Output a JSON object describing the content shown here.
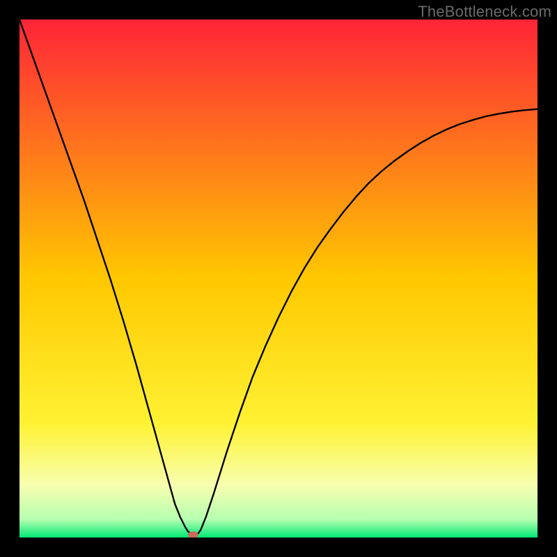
{
  "watermark": "TheBottleneck.com",
  "chart_data": {
    "type": "line",
    "title": "",
    "xlabel": "",
    "ylabel": "",
    "xlim": [
      0,
      1
    ],
    "ylim": [
      0,
      1
    ],
    "grid": false,
    "legend": false,
    "background_gradient": {
      "stops": [
        {
          "offset": 0.0,
          "color": "#ff2438"
        },
        {
          "offset": 0.5,
          "color": "#ffc800"
        },
        {
          "offset": 0.78,
          "color": "#fff233"
        },
        {
          "offset": 0.9,
          "color": "#f7ffb0"
        },
        {
          "offset": 0.965,
          "color": "#b6ffb0"
        },
        {
          "offset": 1.0,
          "color": "#00e874"
        }
      ]
    },
    "curve": {
      "description": "V-shaped curve. Left branch nearly straight from top-left to a flat minimum around x≈0.33; right branch curves upward with decreasing slope toward the right edge at y≈0.82.",
      "x": [
        0.0,
        0.025,
        0.05,
        0.075,
        0.1,
        0.125,
        0.15,
        0.175,
        0.2,
        0.225,
        0.25,
        0.275,
        0.3,
        0.31,
        0.32,
        0.325,
        0.33,
        0.333,
        0.34,
        0.345,
        0.35,
        0.36,
        0.375,
        0.4,
        0.425,
        0.45,
        0.475,
        0.5,
        0.525,
        0.55,
        0.575,
        0.6,
        0.625,
        0.65,
        0.675,
        0.7,
        0.725,
        0.75,
        0.775,
        0.8,
        0.825,
        0.85,
        0.875,
        0.9,
        0.925,
        0.95,
        0.975,
        1.0
      ],
      "y": [
        1.0,
        0.93,
        0.86,
        0.79,
        0.72,
        0.65,
        0.575,
        0.5,
        0.42,
        0.335,
        0.245,
        0.155,
        0.065,
        0.04,
        0.02,
        0.012,
        0.008,
        0.005,
        0.005,
        0.008,
        0.015,
        0.04,
        0.085,
        0.165,
        0.24,
        0.31,
        0.37,
        0.425,
        0.475,
        0.52,
        0.56,
        0.595,
        0.628,
        0.658,
        0.685,
        0.708,
        0.728,
        0.746,
        0.762,
        0.776,
        0.788,
        0.798,
        0.806,
        0.813,
        0.818,
        0.822,
        0.825,
        0.827
      ]
    },
    "marker": {
      "x": 0.335,
      "y": 0.005,
      "rx": 0.01,
      "ry": 0.007,
      "color": "#c86a5a"
    }
  }
}
